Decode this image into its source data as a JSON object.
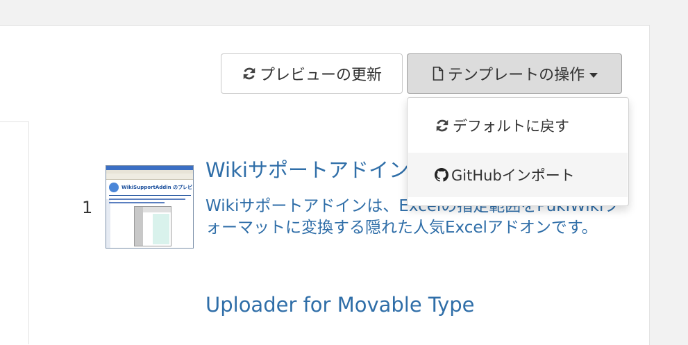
{
  "toolbar": {
    "preview_label": "プレビューの更新",
    "template_label": "テンプレートの操作"
  },
  "dropdown": {
    "items": [
      {
        "label": "デフォルトに戻す",
        "icon": "refresh-icon"
      },
      {
        "label": "GitHubインポート",
        "icon": "github-icon"
      }
    ]
  },
  "results": [
    {
      "rank": "1",
      "title": "Wikiサポートアドイン",
      "description": "Wikiサポートアドインは、Excelの指定範囲をPukiWikiフォーマットに変換する隠れた人気Excelアドオンです。",
      "thumbnail_heading": "WikiSupportAddin のプレビュー"
    },
    {
      "title": "Uploader for Movable Type"
    }
  ],
  "colors": {
    "link": "#2f6ea8",
    "button_active_bg": "#dcdcdc",
    "hover_bg": "#f5f5f5"
  }
}
